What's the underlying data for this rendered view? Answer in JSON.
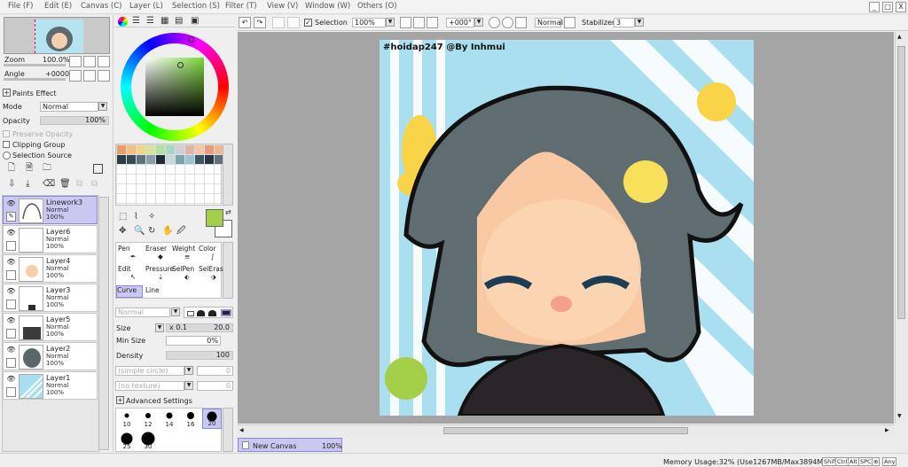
{
  "menu": [
    "File (F)",
    "Edit (E)",
    "Canvas (C)",
    "Layer (L)",
    "Selection (S)",
    "Filter (T)",
    "View (V)",
    "Window (W)",
    "Others (O)"
  ],
  "window_buttons": [
    "_",
    "□",
    "X"
  ],
  "navigator": {
    "zoom_label": "Zoom",
    "zoom_value": "100.0%",
    "angle_label": "Angle",
    "angle_value": "+0000"
  },
  "paints_effect": {
    "title": "Paints Effect",
    "mode_label": "Mode",
    "mode_value": "Normal",
    "opacity_label": "Opacity",
    "opacity_value": "100%",
    "preserve_opacity": "Preserve Opacity",
    "clipping_group": "Clipping Group",
    "selection_source": "Selection Source"
  },
  "layers": [
    {
      "name": "Linework3",
      "mode": "Normal",
      "opacity": "100%",
      "selected": true
    },
    {
      "name": "Layer6",
      "mode": "Normal",
      "opacity": "100%",
      "selected": false
    },
    {
      "name": "Layer4",
      "mode": "Normal",
      "opacity": "100%",
      "selected": false
    },
    {
      "name": "Layer3",
      "mode": "Normal",
      "opacity": "100%",
      "selected": false
    },
    {
      "name": "Layer5",
      "mode": "Normal",
      "opacity": "100%",
      "selected": false
    },
    {
      "name": "Layer2",
      "mode": "Normal",
      "opacity": "100%",
      "selected": false
    },
    {
      "name": "Layer1",
      "mode": "Normal",
      "opacity": "100%",
      "selected": false
    }
  ],
  "swatches": [
    "#e8a06a",
    "#f2c080",
    "#efd78a",
    "#d7e49a",
    "#b6dfa4",
    "#a7d7c7",
    "#cdd0d6",
    "#e1b4a5",
    "#f5c6a7",
    "#eb9a7e",
    "#f0b890",
    "#2a3d44",
    "#344b54",
    "#5d747e",
    "#8aa0a8",
    "#1e2c33",
    "#c9d8df",
    "#7da2b2",
    "#9ec2cf",
    "#3c5561",
    "#27363e",
    "#5e7078"
  ],
  "colors": {
    "primary": "#a3d048",
    "secondary": "#ffffff",
    "accent_selection": "#c9c8f2",
    "canvas_bg": "#a5a5a5"
  },
  "tools": [
    {
      "label": "Pen",
      "icon": "pen-icon"
    },
    {
      "label": "Eraser",
      "icon": "eraser-icon"
    },
    {
      "label": "Weight",
      "icon": "weight-icon"
    },
    {
      "label": "Color",
      "icon": "color-icon"
    },
    {
      "label": "Edit",
      "icon": "edit-icon"
    },
    {
      "label": "Pressure",
      "icon": "pressure-icon"
    },
    {
      "label": "SelPen",
      "icon": "selpen-icon"
    },
    {
      "label": "SelEras",
      "icon": "seleras-icon"
    },
    {
      "label": "Curve",
      "icon": "curve-icon"
    },
    {
      "label": "Line",
      "icon": "line-icon"
    }
  ],
  "brush": {
    "blend_value": "Normal",
    "size_label": "Size",
    "size_mult": "x 0.1",
    "size_value": "20.0",
    "min_size_label": "Min Size",
    "min_size_value": "0%",
    "density_label": "Density",
    "density_value": "100",
    "shape_value": "(simple circle)",
    "texture_value": "(no texture)",
    "shape_amount": "0",
    "texture_amount": "0",
    "advanced": "Advanced Settings",
    "sizes": [
      "10",
      "12",
      "14",
      "16",
      "20",
      "25",
      "30"
    ],
    "selected_size": "20"
  },
  "toolbar": {
    "selection_label": "Selection",
    "zoom_value": "100%",
    "angle_value": "+000°",
    "blend_value": "Normal",
    "stabilizer_label": "Stabilizer",
    "stabilizer_value": "3"
  },
  "canvas": {
    "watermark": "#hoidap247 @By Inhmui",
    "tab_name": "New Canvas",
    "tab_zoom": "100%"
  },
  "status": {
    "memory": "Memory Usage:32% (Use1267MB/Max3894MB)",
    "keys": [
      "Shift",
      "Ctrl",
      "Alt",
      "SPC",
      "⊕",
      "Any"
    ]
  }
}
